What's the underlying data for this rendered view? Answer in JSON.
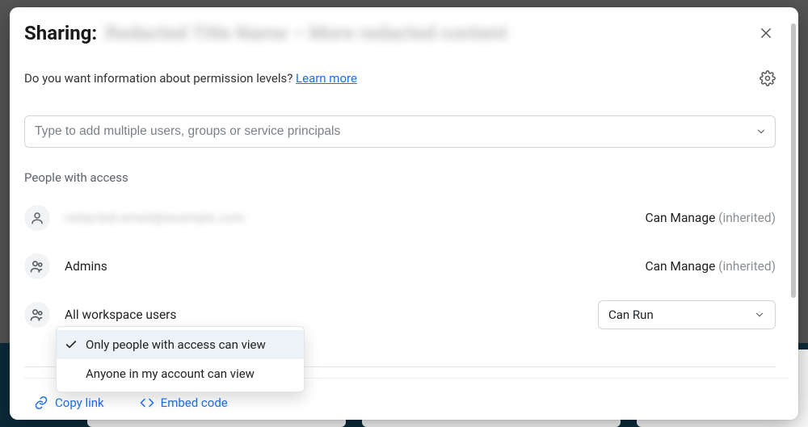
{
  "header": {
    "title_prefix": "Sharing:",
    "title_blurred": "Redacted Title Name – More redacted content"
  },
  "subhead": {
    "prompt": "Do you want information about permission levels? ",
    "learn_more": "Learn more"
  },
  "search": {
    "placeholder": "Type to add multiple users, groups or service principals"
  },
  "section_label": "People with access",
  "rows": [
    {
      "name_blurred": "redacted.email@example.com",
      "perm_label": "Can Manage",
      "perm_suffix": "(inherited)"
    },
    {
      "name": "Admins",
      "perm_label": "Can Manage",
      "perm_suffix": "(inherited)"
    },
    {
      "name": "All workspace users",
      "perm_select": "Can Run"
    }
  ],
  "visibility_menu": {
    "options": [
      "Only people with access can view",
      "Anyone in my account can view"
    ],
    "selected": "Only people with access can view"
  },
  "footer": {
    "copy_link": "Copy link",
    "embed_code": "Embed code"
  }
}
